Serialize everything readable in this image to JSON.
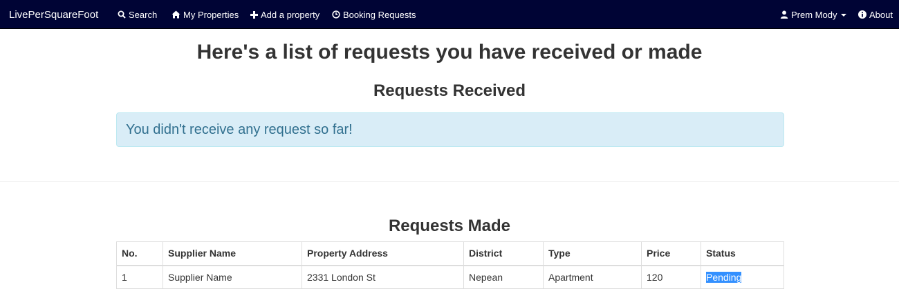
{
  "navbar": {
    "brand": "LivePerSquareFoot",
    "items": [
      {
        "label": "Search",
        "icon": "search-icon"
      },
      {
        "label": "My Properties",
        "icon": "home-icon"
      },
      {
        "label": "Add a property",
        "icon": "plus-icon"
      },
      {
        "label": "Booking Requests",
        "icon": "clock-icon"
      }
    ],
    "user": {
      "label": "Prem Mody",
      "icon": "user-icon"
    },
    "about": {
      "label": "About",
      "icon": "info-icon"
    },
    "background": "#000435"
  },
  "main": {
    "heading": "Here's a list of requests you have received or made",
    "received": {
      "title": "Requests Received",
      "empty_message": "You didn't receive any request so far!"
    },
    "made": {
      "title": "Requests Made",
      "columns": [
        "No.",
        "Supplier Name",
        "Property Address",
        "District",
        "Type",
        "Price",
        "Status"
      ],
      "rows": [
        {
          "no": "1",
          "supplier": "Supplier Name",
          "address": "2331 London St",
          "district": "Nepean",
          "type": "Apartment",
          "price": "120",
          "status": "Pending"
        }
      ]
    }
  },
  "colors": {
    "alert_bg": "#d9edf7",
    "alert_text": "#31708f",
    "selection": "#3390ff"
  }
}
